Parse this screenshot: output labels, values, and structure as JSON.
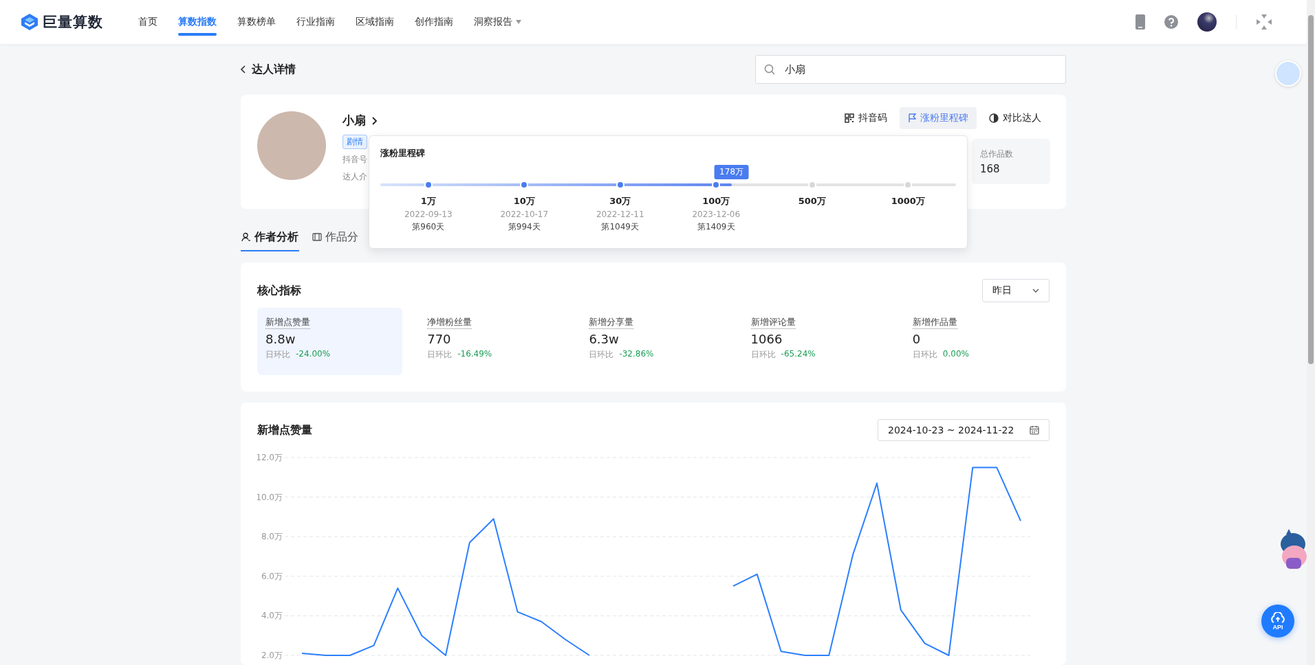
{
  "header": {
    "brand": "巨量算数",
    "nav": [
      {
        "label": "首页",
        "selected": false,
        "dropdown": false
      },
      {
        "label": "算数指数",
        "selected": true,
        "dropdown": false
      },
      {
        "label": "算数榜单",
        "selected": false,
        "dropdown": false
      },
      {
        "label": "行业指南",
        "selected": false,
        "dropdown": false
      },
      {
        "label": "区域指南",
        "selected": false,
        "dropdown": false
      },
      {
        "label": "创作指南",
        "selected": false,
        "dropdown": false
      },
      {
        "label": "洞察报告",
        "selected": false,
        "dropdown": true
      }
    ]
  },
  "page": {
    "back_title": "达人详情",
    "search": {
      "value": "小扇"
    }
  },
  "profile": {
    "name": "小扇",
    "tag": "剧情",
    "handle_label": "抖音号",
    "intro_label": "达人介",
    "actions": [
      {
        "label": "抖音码",
        "kind": "qr",
        "selected": false
      },
      {
        "label": "涨粉里程碑",
        "kind": "flag",
        "selected": true
      },
      {
        "label": "对比达人",
        "kind": "compare",
        "selected": false
      }
    ],
    "stat": {
      "label": "总作品数",
      "value": "168"
    }
  },
  "milestones": {
    "title": "涨粉里程碑",
    "level": 0.61,
    "current": "178万",
    "items": [
      {
        "label": "1万",
        "date": "2022-09-13",
        "day": "第960天",
        "reached": true
      },
      {
        "label": "10万",
        "date": "2022-10-17",
        "day": "第994天",
        "reached": true
      },
      {
        "label": "30万",
        "date": "2022-12-11",
        "day": "第1049天",
        "reached": true
      },
      {
        "label": "100万",
        "date": "2023-12-06",
        "day": "第1409天",
        "reached": true
      },
      {
        "label": "500万",
        "reached": false
      },
      {
        "label": "1000万",
        "reached": false
      }
    ]
  },
  "tabs": [
    {
      "label": "作者分析",
      "kind": "person",
      "selected": true
    },
    {
      "label": "作品分",
      "kind": "film",
      "selected": false
    }
  ],
  "core_metrics": {
    "title": "核心指标",
    "period": "昨日",
    "items": [
      {
        "label": "新增点赞量",
        "value": "8.8w",
        "compare_label": "日环比",
        "change": "-24.00%",
        "selected": true
      },
      {
        "label": "净增粉丝量",
        "value": "770",
        "compare_label": "日环比",
        "change": "-16.49%",
        "selected": false
      },
      {
        "label": "新增分享量",
        "value": "6.3w",
        "compare_label": "日环比",
        "change": "-32.86%",
        "selected": false
      },
      {
        "label": "新增评论量",
        "value": "1066",
        "compare_label": "日环比",
        "change": "-65.24%",
        "selected": false
      },
      {
        "label": "新增作品量",
        "value": "0",
        "compare_label": "日环比",
        "change": "0.00%",
        "selected": false
      }
    ]
  },
  "likes_chart": {
    "title": "新增点赞量",
    "date_range": "2024-10-23 ~ 2024-11-22",
    "chart_data": {
      "type": "line",
      "grid": true,
      "ylim": [
        2,
        12
      ],
      "yticks": [
        {
          "value": 2,
          "label": "2.0万"
        },
        {
          "value": 4,
          "label": "4.0万"
        },
        {
          "value": 6,
          "label": "6.0万"
        },
        {
          "value": 8,
          "label": "8.0万"
        },
        {
          "value": 10,
          "label": "10.0万"
        },
        {
          "value": 12,
          "label": "12.0万"
        }
      ],
      "series": [
        {
          "color": "#2b7fff",
          "values": [
            2.1,
            2.0,
            2.0,
            2.5,
            5.4,
            3.0,
            2.0,
            7.7,
            8.9,
            4.2,
            3.7,
            2.8,
            2.0,
            null,
            null,
            null,
            null,
            null,
            5.5,
            6.1,
            2.2,
            2.0,
            2.0,
            7.1,
            10.7,
            4.3,
            2.6,
            2.0,
            11.5,
            11.5,
            8.8
          ]
        }
      ]
    }
  },
  "api_button": {
    "label": "API"
  }
}
